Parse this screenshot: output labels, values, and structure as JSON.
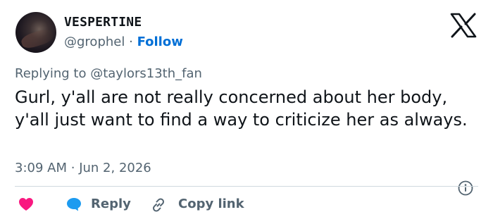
{
  "author": {
    "display_name": "VESPERTINE",
    "handle": "@grophel",
    "separator": "·",
    "follow_label": "Follow"
  },
  "icons": {
    "brand": "x-logo-icon",
    "info": "info-icon",
    "like": "heart-icon",
    "reply": "reply-bubble-icon",
    "copy": "link-icon"
  },
  "reply_context": {
    "prefix": "Replying to",
    "mention": "@taylors13th_fan"
  },
  "tweet": {
    "text": "Gurl, y'all are not really concerned about her body, y'all just want to find a way to criticize her as always.",
    "time": "3:09 AM",
    "separator": "·",
    "date": "Jun 2, 2026"
  },
  "actions": {
    "reply_label": "Reply",
    "copy_label": "Copy link"
  },
  "colors": {
    "follow": "#006fd6",
    "heart": "#f91880",
    "reply_bubble": "#1d9bf0",
    "muted": "#536471",
    "text": "#0f1419"
  }
}
